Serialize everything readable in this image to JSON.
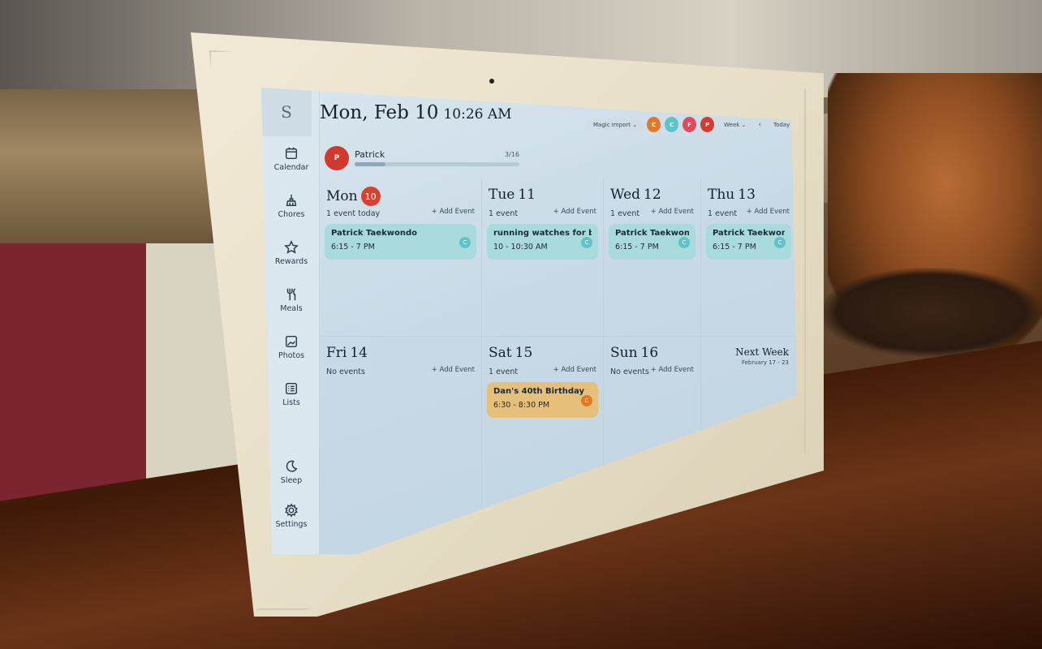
{
  "app": {
    "logo_letter": "S",
    "header": {
      "date": "Mon, Feb 10",
      "time": "10:26 AM"
    },
    "toolbar": {
      "magic_import_label": "Magic Import",
      "view_select": "Week",
      "today_label": "Today",
      "prev_icon": "chevron-left-icon",
      "next_icon": "chevron-right-icon",
      "profiles": [
        {
          "initial": "C",
          "color": "#e07a28"
        },
        {
          "initial": "C",
          "color": "#5fc4c9"
        },
        {
          "initial": "F",
          "color": "#e04a5e"
        },
        {
          "initial": "P",
          "color": "#d73a2e"
        }
      ]
    },
    "sidebar": {
      "items": [
        {
          "label": "Calendar",
          "icon": "calendar-icon"
        },
        {
          "label": "Chores",
          "icon": "broom-icon"
        },
        {
          "label": "Rewards",
          "icon": "star-icon"
        },
        {
          "label": "Meals",
          "icon": "utensils-icon"
        },
        {
          "label": "Photos",
          "icon": "image-icon"
        },
        {
          "label": "Lists",
          "icon": "list-icon"
        },
        {
          "label": "Sleep",
          "icon": "moon-icon"
        },
        {
          "label": "Settings",
          "icon": "gear-icon"
        }
      ]
    },
    "profile_progress": {
      "initial": "P",
      "name": "Patrick",
      "count": "3/16",
      "fraction": 0.1875,
      "color": "#d03a2e"
    },
    "days": [
      {
        "name": "Mon",
        "num": "10",
        "is_today": true,
        "subtitle": "1 event today",
        "add_label": "+ Add Event",
        "events": [
          {
            "title": "Patrick Taekwondo",
            "time": "6:15 - 7 PM",
            "tag": "C",
            "color": "#a9dbdc",
            "tag_color": "#5fc4c9"
          }
        ]
      },
      {
        "name": "Tue",
        "num": "11",
        "is_today": false,
        "subtitle": "1 event",
        "add_label": "+ Add Event",
        "events": [
          {
            "title": "running watches for beginners du",
            "time": "10 - 10:30 AM",
            "tag": "C",
            "color": "#a9dbdc",
            "tag_color": "#5fc4c9"
          }
        ]
      },
      {
        "name": "Wed",
        "num": "12",
        "is_today": false,
        "subtitle": "1 event",
        "add_label": "+ Add Event",
        "events": [
          {
            "title": "Patrick Taekwondo",
            "time": "6:15 - 7 PM",
            "tag": "C",
            "color": "#a9dbdc",
            "tag_color": "#5fc4c9"
          }
        ]
      },
      {
        "name": "Thu",
        "num": "13",
        "is_today": false,
        "subtitle": "1 event",
        "add_label": "+ Add Event",
        "events": [
          {
            "title": "Patrick Taekwondo",
            "time": "6:15 - 7 PM",
            "tag": "C",
            "color": "#a9dbdc",
            "tag_color": "#5fc4c9"
          }
        ]
      },
      {
        "name": "Fri",
        "num": "14",
        "is_today": false,
        "subtitle": "No events",
        "add_label": "+ Add Event",
        "events": []
      },
      {
        "name": "Sat",
        "num": "15",
        "is_today": false,
        "subtitle": "1 event",
        "add_label": "+ Add Event",
        "events": [
          {
            "title": "Dan's 40th Birthday",
            "time": "6:30 - 8:30 PM",
            "tag": "C",
            "color": "#e6c07a",
            "tag_color": "#e07a28"
          }
        ]
      },
      {
        "name": "Sun",
        "num": "16",
        "is_today": false,
        "subtitle": "No events",
        "add_label": "+ Add Event",
        "events": []
      }
    ],
    "next_week": {
      "title": "Next Week",
      "range": "February 17 - 23"
    },
    "fab": {
      "icon": "plus-icon",
      "label": "+"
    }
  }
}
